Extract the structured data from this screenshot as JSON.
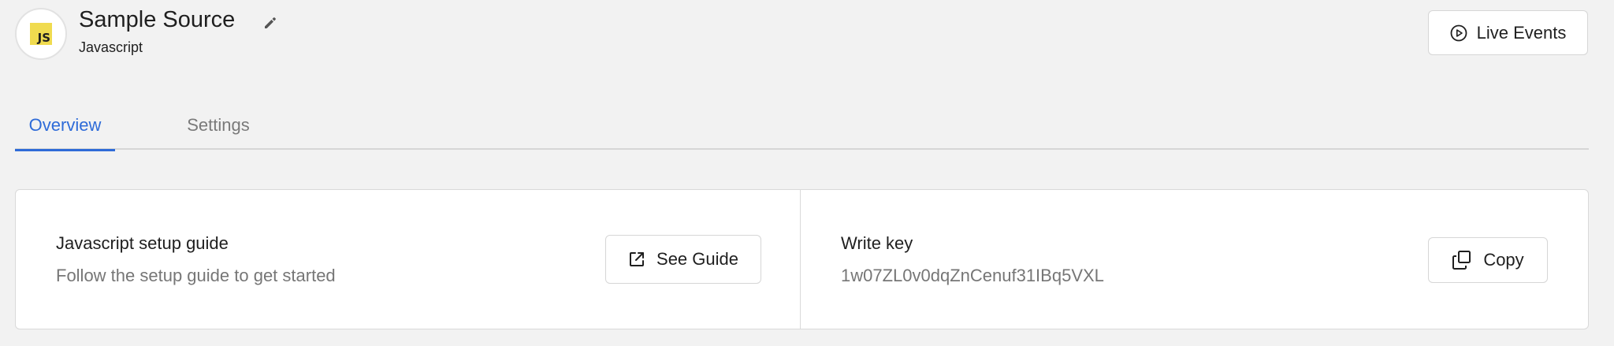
{
  "header": {
    "avatar_badge": "JS",
    "title": "Sample Source",
    "subtitle": "Javascript",
    "edit_icon": "pencil-icon",
    "live_events_label": "Live Events",
    "live_events_icon": "play-circle-icon"
  },
  "tabs": [
    {
      "label": "Overview",
      "active": true
    },
    {
      "label": "Settings",
      "active": false
    }
  ],
  "setup": {
    "title": "Javascript setup guide",
    "description": "Follow the setup guide to get started",
    "button_label": "See Guide",
    "button_icon": "external-link-icon"
  },
  "write_key": {
    "title": "Write key",
    "value": "1w07ZL0v0dqZnCenuf31IBq5VXL",
    "button_label": "Copy",
    "button_icon": "copy-icon"
  },
  "colors": {
    "accent": "#2e6bd8",
    "js_badge": "#f0db4f",
    "background": "#f2f2f2"
  }
}
